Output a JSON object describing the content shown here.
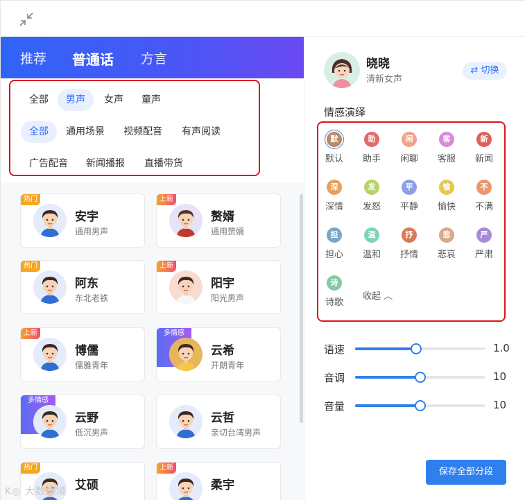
{
  "tabs": [
    "推荐",
    "普通话",
    "方言"
  ],
  "active_tab": "普通话",
  "gender_filters": [
    "全部",
    "男声",
    "女声",
    "童声"
  ],
  "scene_filters": [
    "全部",
    "通用场景",
    "视频配音",
    "有声阅读",
    "广告配音",
    "新闻播报",
    "直播带货"
  ],
  "voices": [
    {
      "name": "安宇",
      "desc": "通用男声",
      "badge": "热门",
      "badge_type": "hot"
    },
    {
      "name": "赘婿",
      "desc": "通用赘婿",
      "badge": "上新",
      "badge_type": "new"
    },
    {
      "name": "阿东",
      "desc": "东北老铁",
      "badge": "热门",
      "badge_type": "hot"
    },
    {
      "name": "阳宇",
      "desc": "阳光男声",
      "badge": "上新",
      "badge_type": "new"
    },
    {
      "name": "博儒",
      "desc": "儒雅青年",
      "badge": "上新",
      "badge_type": "new"
    },
    {
      "name": "云希",
      "desc": "开朗青年",
      "badge": "多情感",
      "badge_type": "emo"
    },
    {
      "name": "云野",
      "desc": "低沉男声",
      "badge": "多情感",
      "badge_type": "emo"
    },
    {
      "name": "云哲",
      "desc": "亲切台湾男声",
      "badge": "",
      "badge_type": ""
    },
    {
      "name": "艾硕",
      "desc": "",
      "badge": "热门",
      "badge_type": "hot"
    },
    {
      "name": "柔宇",
      "desc": "",
      "badge": "上新",
      "badge_type": "new"
    }
  ],
  "current_voice": {
    "name": "晓晓",
    "desc": "清新女声"
  },
  "switch_label": "⇄ 切换",
  "emotion_title": "情感演绎",
  "emotions": [
    {
      "char": "默",
      "label": "默认",
      "color": "#b98a6a"
    },
    {
      "char": "助",
      "label": "助手",
      "color": "#e06b6b"
    },
    {
      "char": "闲",
      "label": "闲聊",
      "color": "#f0a48a"
    },
    {
      "char": "客",
      "label": "客服",
      "color": "#d88ad8"
    },
    {
      "char": "新",
      "label": "新闻",
      "color": "#e0605a"
    },
    {
      "char": "深",
      "label": "深情",
      "color": "#e8a05a"
    },
    {
      "char": "发",
      "label": "发怒",
      "color": "#b5d36a"
    },
    {
      "char": "平",
      "label": "平静",
      "color": "#8aa0e6"
    },
    {
      "char": "愉",
      "label": "愉快",
      "color": "#e8c84a"
    },
    {
      "char": "不",
      "label": "不满",
      "color": "#e8986a"
    },
    {
      "char": "担",
      "label": "担心",
      "color": "#7aa6c8"
    },
    {
      "char": "温",
      "label": "温和",
      "color": "#7fd2b8"
    },
    {
      "char": "抒",
      "label": "抒情",
      "color": "#d87a5a"
    },
    {
      "char": "悲",
      "label": "悲哀",
      "color": "#d8a888"
    },
    {
      "char": "严",
      "label": "严肃",
      "color": "#a88ad8"
    },
    {
      "char": "诗",
      "label": "诗歌",
      "color": "#86c8a6"
    }
  ],
  "selected_emotion": "默认",
  "collapse_label": "收起 ︿",
  "sliders": [
    {
      "label": "语速",
      "value": "1.0",
      "level": 0.47
    },
    {
      "label": "音调",
      "value": "10",
      "level": 0.5
    },
    {
      "label": "音量",
      "value": "10",
      "level": 0.5
    }
  ],
  "save_label": "保存全部分段",
  "watermark": "K◎ 大数据境"
}
